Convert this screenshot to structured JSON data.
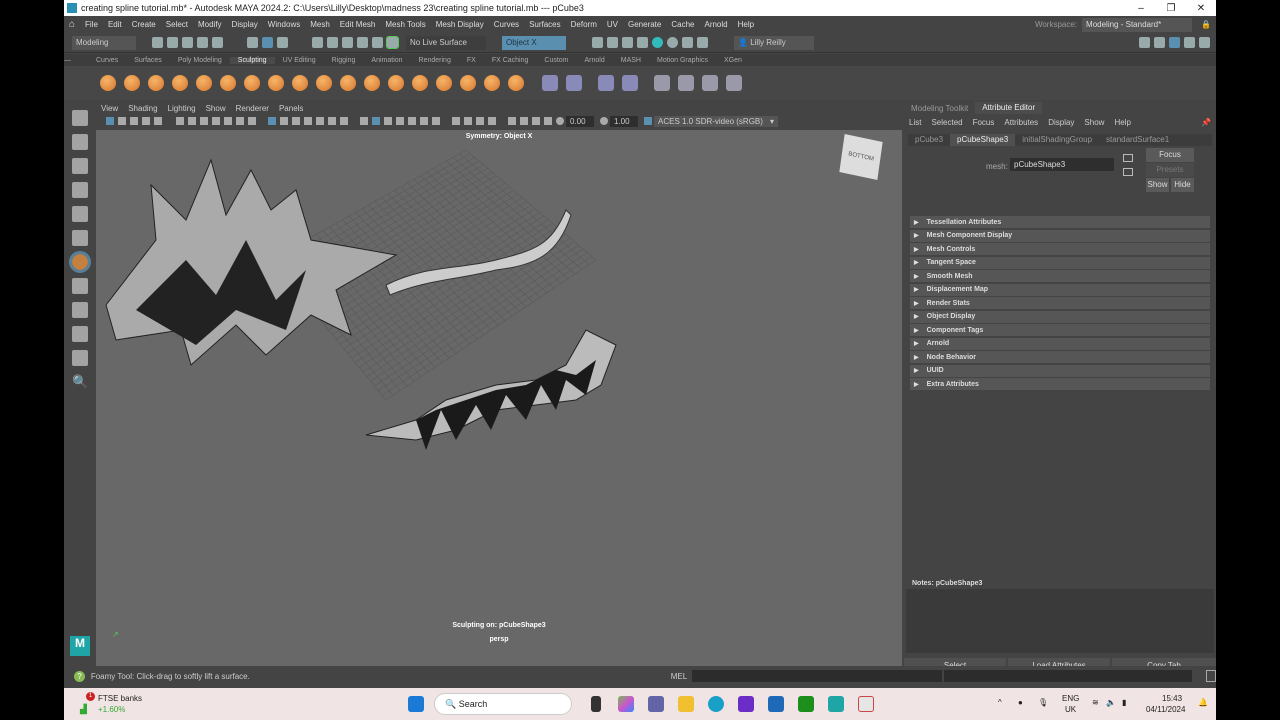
{
  "window": {
    "title": "creating spline tutorial.mb* - Autodesk MAYA 2024.2: C:\\Users\\Lilly\\Desktop\\madness 23\\creating spline tutorial.mb  ---  pCube3",
    "min": "–",
    "max": "❐",
    "close": "✕"
  },
  "menus": [
    "File",
    "Edit",
    "Create",
    "Select",
    "Modify",
    "Display",
    "Windows",
    "Mesh",
    "Edit Mesh",
    "Mesh Tools",
    "Mesh Display",
    "Curves",
    "Surfaces",
    "Deform",
    "UV",
    "Generate",
    "Cache",
    "Arnold",
    "Help"
  ],
  "workspace": {
    "label": "Workspace:",
    "value": "Modeling - Standard*"
  },
  "status": {
    "menuset": "Modeling",
    "live_surface": "No Live Surface",
    "symmetry": "Object X",
    "user": "Lilly Reilly"
  },
  "shelf_tabs": [
    "Curves",
    "Surfaces",
    "Poly Modeling",
    "Sculpting",
    "UV Editing",
    "Rigging",
    "Animation",
    "Rendering",
    "FX",
    "FX Caching",
    "Custom",
    "Arnold",
    "MASH",
    "Motion Graphics",
    "XGen"
  ],
  "shelf_active": "Sculpting",
  "viewport": {
    "menus": [
      "View",
      "Shading",
      "Lighting",
      "Show",
      "Renderer",
      "Panels"
    ],
    "exposure": "0.00",
    "gamma": "1.00",
    "color_space": "ACES 1.0 SDR-video (sRGB)",
    "symmetry_label": "Symmetry: Object X",
    "sculpting_on": "Sculpting on: pCubeShape3",
    "camera": "persp",
    "viewcube": "BOTTOM"
  },
  "attribute_editor": {
    "tabs": [
      "Modeling Toolkit",
      "Attribute Editor"
    ],
    "menus": [
      "List",
      "Selected",
      "Focus",
      "Attributes",
      "Display",
      "Show",
      "Help"
    ],
    "node_tabs": [
      "pCube3",
      "pCubeShape3",
      "initialShadingGroup",
      "standardSurface1"
    ],
    "mesh_label": "mesh:",
    "mesh_value": "pCubeShape3",
    "focus": "Focus",
    "presets": "Presets",
    "show": "Show",
    "hide": "Hide",
    "sections": [
      "Tessellation Attributes",
      "Mesh Component Display",
      "Mesh Controls",
      "Tangent Space",
      "Smooth Mesh",
      "Displacement Map",
      "Render Stats",
      "Object Display",
      "Component Tags",
      "Arnold",
      "Node Behavior",
      "UUID",
      "Extra Attributes"
    ],
    "notes": "Notes: pCubeShape3",
    "select": "Select",
    "load": "Load Attributes",
    "copy": "Copy Tab"
  },
  "helpline": {
    "text": "Foamy Tool: Click-drag to softly lift a surface.",
    "mel": "MEL"
  },
  "taskbar": {
    "widget_title": "FTSE banks",
    "widget_value": "+1.60%",
    "badge": "1",
    "search": "Search",
    "lang1": "ENG",
    "lang2": "UK",
    "time": "15:43",
    "date": "04/11/2024"
  }
}
